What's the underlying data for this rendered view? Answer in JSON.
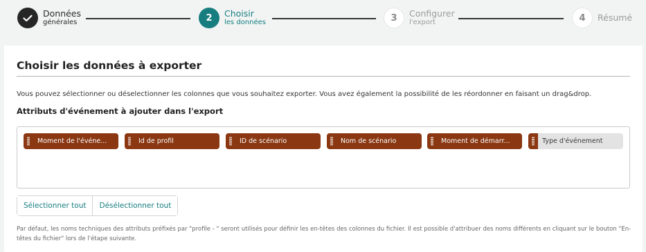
{
  "stepper": {
    "steps": [
      {
        "number": "",
        "title": "Données",
        "subtitle": "générales",
        "state": "done"
      },
      {
        "number": "2",
        "title": "Choisir",
        "subtitle": "les données",
        "state": "active"
      },
      {
        "number": "3",
        "title": "Configurer",
        "subtitle": "l'export",
        "state": "todo"
      },
      {
        "number": "4",
        "title": "Résumé",
        "subtitle": "",
        "state": "todo"
      }
    ]
  },
  "main": {
    "title": "Choisir les données à exporter",
    "intro": "Vous pouvez sélectionner ou déselectionner les colonnes que vous souhaitez exporter. Vous avez également la possibilité de les réordonner en faisant un drag&drop.",
    "section_title": "Attributs d'événement à ajouter dans l'export",
    "attributes": [
      {
        "label": "Moment de l'événe...",
        "selected": true
      },
      {
        "label": "Id de profil",
        "selected": true
      },
      {
        "label": "ID de scénario",
        "selected": true
      },
      {
        "label": "Nom de scénario",
        "selected": true
      },
      {
        "label": "Moment de démarr...",
        "selected": true
      },
      {
        "label": "Type d'événement",
        "selected": false
      }
    ],
    "select_all_label": "Sélectionner tout",
    "deselect_all_label": "Désélectionner tout",
    "note": "Par défaut, les noms techniques des attributs préfixés par \"profile - \" seront utilisés pour définir les en-têtes des colonnes du fichier. Il est possible d'attribuer des noms différents en cliquant sur le bouton \"En-têtes du fichier\" lors de l'étape suivante."
  },
  "colors": {
    "accent": "#177d7f",
    "chip": "#8a3712",
    "chip_inactive": "#e3e3e3",
    "done": "#262626"
  },
  "icons": {
    "done_step": "check-icon",
    "chip_handle": "drag-handle-icon"
  }
}
